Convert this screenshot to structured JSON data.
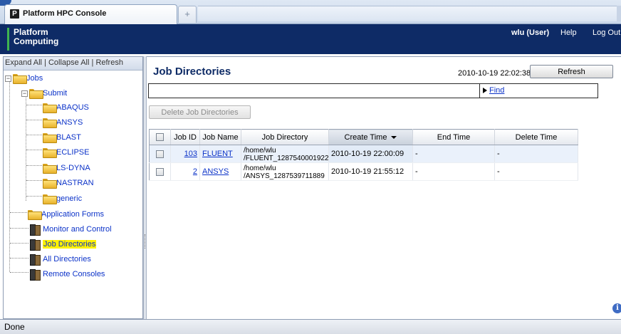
{
  "browser": {
    "tab_title": "Platform HPC Console",
    "favicon_letter": "P",
    "new_tab_glyph": "+"
  },
  "header": {
    "logo_line1": "Platform",
    "logo_line2": "Computing",
    "user": "wlu (User)",
    "help": "Help",
    "logout": "Log Out",
    "brand_color": "#0e2b66",
    "logo_accent": "#3fb34f"
  },
  "tree": {
    "toolbar": {
      "expand_all": "Expand All",
      "collapse_all": "Collapse All",
      "refresh": "Refresh",
      "sep": "|"
    },
    "nodes": {
      "jobs": "Jobs",
      "submit": "Submit",
      "abaqus": "ABAQUS",
      "ansys": "ANSYS",
      "blast": "BLAST",
      "eclipse": "ECLIPSE",
      "lsdyna": "LS-DYNA",
      "nastran": "NASTRAN",
      "generic": "generic",
      "app_forms": "Application Forms",
      "monitor": "Monitor and Control",
      "job_dirs": "Job Directories",
      "all_dirs": "All Directories",
      "remote": "Remote Consoles"
    },
    "expander_minus": "−",
    "selected_highlight": "#fff200"
  },
  "main": {
    "title": "Job Directories",
    "timestamp": "2010-10-19 22:02:38",
    "refresh_label": "Refresh",
    "find_label": "Find",
    "delete_label": "Delete Job Directories",
    "columns": {
      "job_id": "Job ID",
      "job_name": "Job Name",
      "job_dir": "Job Directory",
      "create_time": "Create Time",
      "end_time": "End Time",
      "delete_time": "Delete Time"
    },
    "rows": [
      {
        "job_id": "103",
        "job_name": "FLUENT",
        "dir_line1": "/home/wlu",
        "dir_line2": "/FLUENT_1287540001922",
        "create_time": "2010-10-19 22:00:09",
        "end_time": "-",
        "delete_time": "-"
      },
      {
        "job_id": "2",
        "job_name": "ANSYS",
        "dir_line1": "/home/wlu",
        "dir_line2": "/ANSYS_1287539711889",
        "create_time": "2010-10-19 21:55:12",
        "end_time": "-",
        "delete_time": "-"
      }
    ]
  },
  "status": {
    "text": "Done"
  },
  "info_icon_glyph": "i"
}
